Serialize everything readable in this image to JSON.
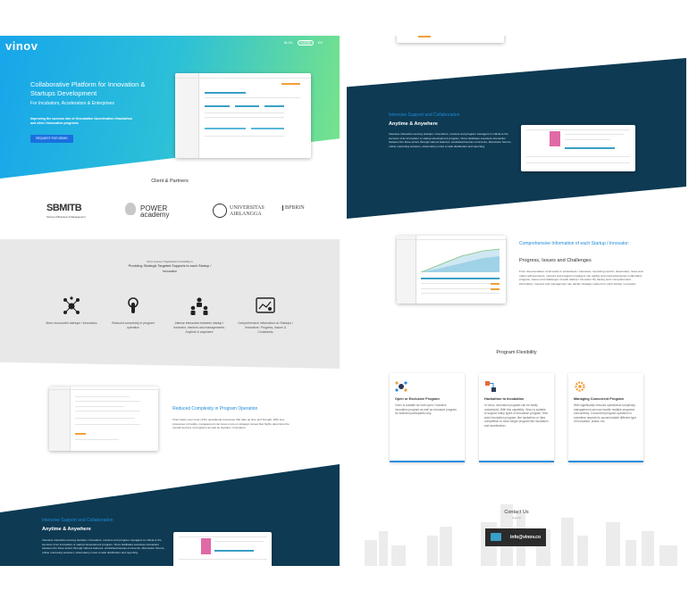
{
  "header": {
    "logo": "vinov",
    "nav_blog": "BLOG",
    "login": "LOGIN",
    "lang": "EN"
  },
  "hero": {
    "title": "Collaborative Platform for Innovation & Startups Development",
    "subtitle": "For Incubators, Accelerators & Enterprises",
    "desc": "Improving the success rate of #incubation #acceleration #hackathon and other #innovation programs",
    "cta": "REQUEST FOR DEMO"
  },
  "partners": {
    "title": "Client & Partners",
    "items": [
      "SBMITB",
      "School of Business & Management",
      "POWER academy",
      "UNIVERSITAS AIRLANGGA",
      "BPBRIN"
    ]
  },
  "value": {
    "eyebrow": "Vinov Improve Organization's Flexibility in",
    "title": "Providing Strategic Targeted Supports to each Startup / Innovator",
    "features": [
      {
        "icon": "network-icon",
        "text": "More resourceful startups / innovators"
      },
      {
        "icon": "touch-icon",
        "text": "Reduced complexity in program operation"
      },
      {
        "icon": "team-icon",
        "text": "Intense interaction between startup / innovator, mentors and managements. Anytime & anywhere"
      },
      {
        "icon": "report-icon",
        "text": "Comprehensive Information on Startups / Innovators: Progress, Issues & Constraints"
      }
    ]
  },
  "reduced": {
    "title": "Reduced Complexity in Program Operation",
    "body": "Vinov takes over most of the operational processes that take up time and thought. With less processes to handle, management can focus more on strategic issues that highly determine the overall success of programs as well as startups / innovators."
  },
  "support": {
    "title": "Intensive Support and Collaboration",
    "subtitle": "Anytime & Anywhere",
    "body": "Intensive interaction among startups / innovators, mentors and program managers is critical to the success of an innovation or startup development program. Vinov facilitates seamless interaction between the three actors through various features: worksheet/canvas comments, discussion forums, online mentoring sessions, observatory notes to task distribution and reporting."
  },
  "comprehensive": {
    "title": "Comprehensive Information of each Startup / Innovator:",
    "subtitle": "Progress, Issues and Challenges",
    "body": "From documentation of all works in worksheets / canvases, mentoring reports, observatory notes and matrix achievements, mentors and program managers can quickly and comprehensively understand progress, issues and challenges of each startup / innovator. By having such comprehensive information, mentors and management can decide strategic support for each startup / innovator."
  },
  "flexibility": {
    "title": "Program Flexibility",
    "cards": [
      {
        "icon": "open-program-icon",
        "title": "Open or Exclusive Program",
        "text": "Vinov is suitable for both open / inclusive innovation program as well as exclusive program for selected participants only."
      },
      {
        "icon": "hackathon-icon",
        "title": "Hackathon to Incubation",
        "text": "In Vinov, innovation program can be easily customized. With this capability, Vinov is suitable to support many types of innovation program, from short incubation program, like hackathon or idea competition to more longer program like incubation and acceleration."
      },
      {
        "icon": "gear-icon",
        "title": "Managing Concurrent Program",
        "text": "With significantly reduced operational complexity, management can now handle multiple programs concurrently. Concurrent program operation is sometime required to accommodate different type of innovation, phase, etc."
      }
    ]
  },
  "contact": {
    "title": "Contact Us",
    "sub": "vinov.co",
    "email": "info@vinov.co"
  }
}
